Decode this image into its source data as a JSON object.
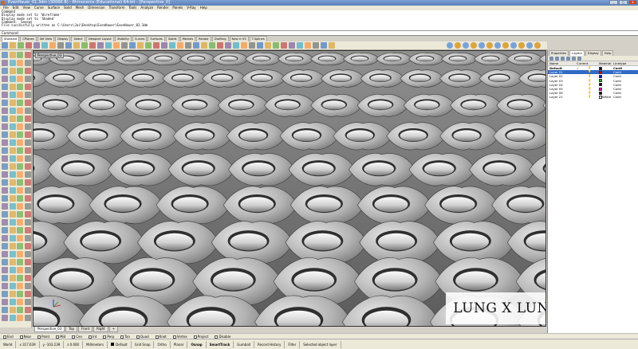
{
  "window": {
    "title": "EvenHauer_01.3dm (3006K B) - Rhinoceros (Educational) 64-bit - [Perspective_0]",
    "buttons": {
      "minimize": "_",
      "maximize": "□",
      "close": "x"
    }
  },
  "menu": [
    "File",
    "Edit",
    "View",
    "Curve",
    "Surface",
    "Solid",
    "Mesh",
    "Dimension",
    "Transform",
    "Tools",
    "Analyze",
    "Render",
    "Panels",
    "V-Ray",
    "Help"
  ],
  "history": [
    "Command",
    "Display mode set to 'Wireframe'",
    "Display mode set to 'Shaded'",
    "Command: _Saveas",
    "File successfully written as C:\\Users\\Jai\\Desktop\\EvenHauer\\EvenHauer_01.3dm"
  ],
  "command_prompt": "Command:",
  "toolbar_tabs": [
    "Standard",
    "CPlanes",
    "Set View",
    "Display",
    "Select",
    "Viewport Layout",
    "Visibility",
    "Curves",
    "Surfaces",
    "Solids",
    "Meshes",
    "Render",
    "Drafting",
    "New in V5",
    "T-Splines"
  ],
  "viewport": {
    "label": "Perspective_03"
  },
  "viewport_tabs": [
    "Perspective_03",
    "Top",
    "Front",
    "Right",
    "+"
  ],
  "osnap": [
    "End",
    "Near",
    "Point",
    "Mid",
    "Cen",
    "Int",
    "Perp",
    "Tan",
    "Quad",
    "Knot",
    "Vertex",
    "Project",
    "Disable"
  ],
  "status": {
    "plane": "World",
    "x": "x 317.639",
    "y": "y -103.239",
    "z": "z 0.000",
    "units": "Millimeters",
    "layer": "Default",
    "toggles": [
      "Grid Snap",
      "Ortho",
      "Planar",
      "Osnap",
      "SmartTrack",
      "Gumball",
      "Record History",
      "Filter"
    ],
    "message": "Selected object layer"
  },
  "panel": {
    "tabs": [
      "Properties",
      "Layers",
      "Display",
      "Help"
    ],
    "columns": [
      "Name",
      "Current",
      "",
      "Material",
      "Linetype"
    ],
    "layers": [
      {
        "name": "Default",
        "current": "✓",
        "material": "",
        "linetype": "Conti",
        "color": "#000000"
      },
      {
        "name": "Layer 01",
        "current": "",
        "material": "",
        "linetype": "Conti",
        "color": "#ff0000"
      },
      {
        "name": "Layer 02",
        "current": "",
        "material": "",
        "linetype": "Conti",
        "color": "#0000ff"
      },
      {
        "name": "Layer 03",
        "current": "",
        "material": "",
        "linetype": "Conti",
        "color": "#00c000"
      },
      {
        "name": "Layer 04",
        "current": "",
        "material": "",
        "linetype": "Conti",
        "color": "#000000"
      },
      {
        "name": "Layer 05",
        "current": "",
        "material": "",
        "linetype": "Conti",
        "color": "#ff00ff"
      },
      {
        "name": "Layer 06",
        "current": "",
        "material": "",
        "linetype": "Conti",
        "color": "#000000"
      },
      {
        "name": "Layer 21",
        "current": "",
        "material": "White",
        "linetype": "Conti",
        "color": "#ffffff"
      }
    ]
  },
  "watermark": "LUNG X LUNG DESIGN"
}
